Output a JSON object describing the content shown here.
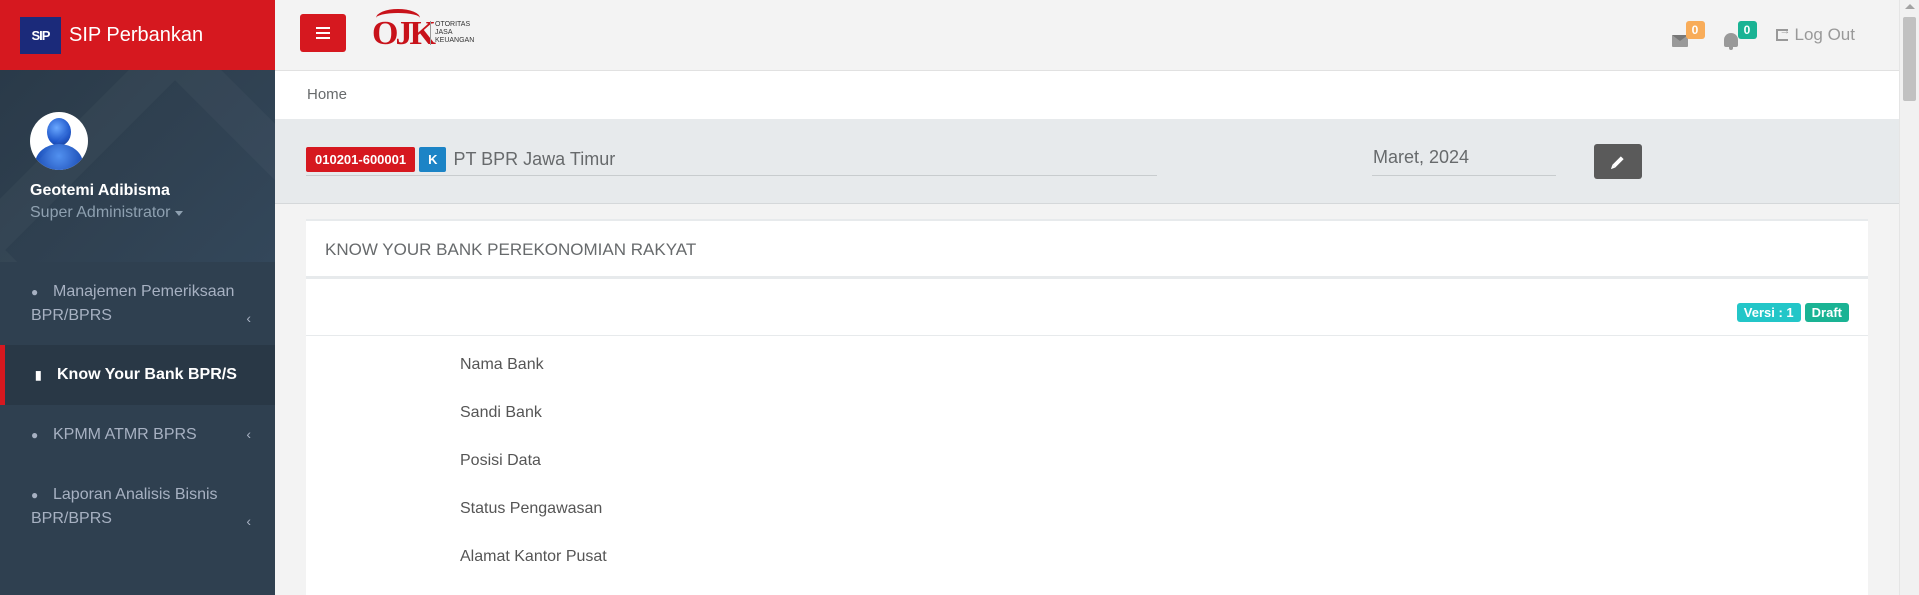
{
  "brand": {
    "logo": "SIP",
    "title": "SIP Perbankan",
    "accent": "#d6181f"
  },
  "user": {
    "name": "Geotemi Adibisma",
    "role": "Super Administrator"
  },
  "sidebar": {
    "items": [
      {
        "icon": "comments-icon",
        "label": "Manajemen Pemeriksaan BPR/BPRS",
        "active": false,
        "has_children": true
      },
      {
        "icon": "book-icon",
        "label": "Know Your Bank BPR/S",
        "active": true,
        "has_children": false
      },
      {
        "icon": "comments-icon",
        "label": "KPMM ATMR BPRS",
        "active": false,
        "has_children": true
      },
      {
        "icon": "comments-icon",
        "label": "Laporan Analisis Bisnis BPR/BPRS",
        "active": false,
        "has_children": true
      }
    ]
  },
  "topbar": {
    "ojk": {
      "mark": "OJK",
      "line1": "OTORITAS",
      "line2": "JASA",
      "line3": "KEUANGAN"
    },
    "messages_count": "0",
    "notifications_count": "0",
    "logout_label": "Log Out"
  },
  "breadcrumb": {
    "home": "Home"
  },
  "context": {
    "bank_code": "010201-600001",
    "bank_type": "K",
    "bank_name": "PT BPR Jawa Timur",
    "period": "Maret, 2024"
  },
  "panel": {
    "title": "KNOW YOUR BANK PEREKONOMIAN RAKYAT",
    "version_label": "Versi : 1",
    "status_label": "Draft",
    "fields": [
      "Nama Bank",
      "Sandi Bank",
      "Posisi Data",
      "Status Pengawasan",
      "Alamat Kantor Pusat"
    ]
  }
}
